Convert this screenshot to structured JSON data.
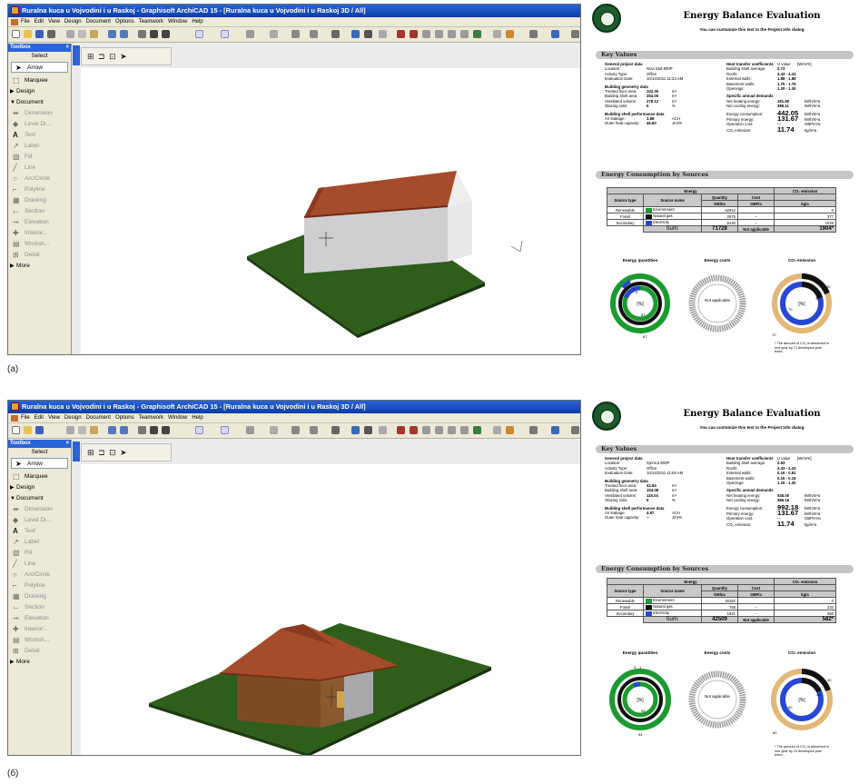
{
  "panels": [
    {
      "label": "(a)",
      "app": {
        "title": "Ruralna kuca u Vojvodini i u Raskoj - Graphisoft ArchiCAD 15 - [Ruralna kuca u Vojvodini i u Raskoj 3D / All]",
        "menus": [
          "File",
          "Edit",
          "View",
          "Design",
          "Document",
          "Options",
          "Teamwork",
          "Window",
          "Help"
        ],
        "toolbox": {
          "title": "Toolbox",
          "select": "Select",
          "tools_main": [
            "Arrow",
            "Marquee"
          ],
          "design_header": "Design",
          "document_header": "Document",
          "doc_tools": [
            "Dimension",
            "Level Di...",
            "Text",
            "Label",
            "Fill",
            "Line",
            "Arc/Circle",
            "Polyline",
            "Drawing",
            "Section",
            "Elevation",
            "Interior...",
            "Worksh...",
            "Detail"
          ],
          "more": "More"
        }
      },
      "report": {
        "title": "Energy Balance Evaluation",
        "subtitle": "You can customize this text in the Project Info dialog",
        "key_values_header": "Key Values",
        "general": {
          "header": "General project data",
          "rows": [
            [
              "Location:",
              "Novi Sad 800P"
            ],
            [
              "Activity Type:",
              "Office"
            ],
            [
              "Evaluation Date:",
              "10/14/2011 11:23 AM"
            ]
          ]
        },
        "geometry": {
          "header": "Building geometry data",
          "rows": [
            [
              "Treated floor area:",
              "102.30",
              "m²"
            ],
            [
              "Building shell area:",
              "254.00",
              "m²"
            ],
            [
              "Ventilated volume:",
              "278.12",
              "m³"
            ],
            [
              "Glazing ratio:",
              "6",
              "%"
            ]
          ]
        },
        "shell": {
          "header": "Building shell performance data",
          "rows": [
            [
              "Air leakage:",
              "3.88",
              "ACH"
            ],
            [
              "Outer heat capacity:",
              "46.60",
              "J/m²K"
            ]
          ]
        },
        "heat_transfer": {
          "header": "Heat transfer coefficients",
          "unit_head": "U value",
          "unit": "[W/m²K]",
          "rows": [
            [
              "Building shell average:",
              "2.73"
            ],
            [
              "Roofs:",
              "4.43 - 4.43"
            ],
            [
              "External walls:",
              "1.88 - 1.88"
            ],
            [
              "Basement walls:",
              "1.75 - 1.75"
            ],
            [
              "Openings:",
              "1.30 - 1.30"
            ]
          ]
        },
        "specific": {
          "header": "Specific annual demands",
          "rows": [
            [
              "Net heating energy:",
              "181.80",
              "kWh/m²a"
            ],
            [
              "Net cooling energy:",
              "386.11",
              "kWh/m²a"
            ]
          ]
        },
        "big": {
          "rows": [
            [
              "Energy consumption:",
              "442.05",
              "kWh/m²a"
            ],
            [
              "Primary energy:",
              "131.67",
              "kWh/m²a"
            ],
            [
              "Operation cost:",
              "---",
              "GBP/m²a"
            ],
            [
              "CO₂ emission:",
              "11.74",
              "kg/m²a"
            ]
          ]
        },
        "consumption_header": "Energy Consumption by Sources",
        "table": {
          "top_headers": [
            "Energy",
            "CO₂ emission"
          ],
          "headers": [
            "Source type",
            "Source name",
            "Quantity",
            "Cost"
          ],
          "units": [
            "kWh/a",
            "GBP/a",
            "kg/a"
          ],
          "rows": [
            {
              "type": "Renewable",
              "name": "Environment",
              "qty": "62912",
              "cost": "",
              "co2": "0",
              "color": "#1a9b2f"
            },
            {
              "type": "Fossil",
              "name": "Natural gas",
              "qty": "2675",
              "cost": "--",
              "co2": "377",
              "color": "#111111"
            },
            {
              "type": "Secondary",
              "name": "Electricity",
              "qty": "6140",
              "cost": "--",
              "co2": "1026",
              "color": "#2747d6"
            }
          ],
          "total_label": "Sum:",
          "total_qty": "71728",
          "total_cost": "Not applicable",
          "total_co2": "1904*"
        },
        "donut_titles": [
          "Energy quantities",
          "Energy costs",
          "CO₂ emission"
        ],
        "donut_center": "[%]",
        "na_text": "Not applicable",
        "qty_labels": [
          "4",
          "9",
          "87",
          "87"
        ],
        "co2_labels": [
          "30",
          "70",
          "70",
          "30"
        ],
        "note": "* The amount of CO₂ is absorbed in one year by 71 developed pine trees."
      }
    },
    {
      "label": "(б)",
      "app": {
        "title": "Ruralna kuca u Vojvodini i u Raskoj - Graphisoft ArchiCAD 15 - [Ruralna kuca u Vojvodini i u Raskoj 3D / All]",
        "menus": [
          "File",
          "Edit",
          "View",
          "Design",
          "Document",
          "Options",
          "Teamwork",
          "Window",
          "Help"
        ],
        "toolbox": {
          "title": "Toolbox",
          "select": "Select",
          "tools_main": [
            "Arrow",
            "Marquee"
          ],
          "design_header": "Design",
          "document_header": "Document",
          "doc_tools": [
            "Dimension",
            "Level Di...",
            "Text",
            "Label",
            "Fill",
            "Line",
            "Arc/Circle",
            "Polyline",
            "Drawing",
            "Section",
            "Elevation",
            "Interior...",
            "Worksh...",
            "Detail"
          ],
          "more": "More"
        }
      },
      "report": {
        "title": "Energy Balance Evaluation",
        "subtitle": "You can customize this text in the Project Info dialog",
        "key_values_header": "Key Values",
        "general": {
          "header": "General project data",
          "rows": [
            [
              "Location:",
              "Sjenica 800P"
            ],
            [
              "Activity Type:",
              "Office"
            ],
            [
              "Evaluation Date:",
              "10/14/2011 11:04 AM"
            ]
          ]
        },
        "geometry": {
          "header": "Building geometry data",
          "rows": [
            [
              "Treated floor area:",
              "42.84",
              "m²"
            ],
            [
              "Building shell area:",
              "154.08",
              "m²"
            ],
            [
              "Ventilated volume:",
              "115.04",
              "m³"
            ],
            [
              "Glazing ratio:",
              "5",
              "%"
            ]
          ]
        },
        "shell": {
          "header": "Building shell performance data",
          "rows": [
            [
              "Air leakage:",
              "4.87",
              "ACH"
            ],
            [
              "Outer heat capacity:",
              "--",
              "J/m²K"
            ]
          ]
        },
        "heat_transfer": {
          "header": "Heat transfer coefficients",
          "unit_head": "U value",
          "unit": "[W/m²K]",
          "rows": [
            [
              "Building shell average:",
              "2.53"
            ],
            [
              "Roofs:",
              "4.43 - 4.43"
            ],
            [
              "External walls:",
              "0.16 - 0.81"
            ],
            [
              "Basement walls:",
              "0.16 - 0.16"
            ],
            [
              "Openings:",
              "1.30 - 1.30"
            ]
          ]
        },
        "specific": {
          "header": "Specific annual demands",
          "rows": [
            [
              "Net heating energy:",
              "548.00",
              "kWh/m²a"
            ],
            [
              "Net cooling energy:",
              "386.16",
              "kWh/m²a"
            ]
          ]
        },
        "big": {
          "rows": [
            [
              "Energy consumption:",
              "992.18",
              "kWh/m²a"
            ],
            [
              "Primary energy:",
              "131.67",
              "kWh/m²a"
            ],
            [
              "Operation cost:",
              "---",
              "GBP/m²a"
            ],
            [
              "CO₂ emission:",
              "11.74",
              "kg/m²a"
            ]
          ]
        },
        "consumption_header": "Energy Consumption by Sources",
        "table": {
          "top_headers": [
            "Energy",
            "CO₂ emission"
          ],
          "headers": [
            "Source type",
            "Source name",
            "Quantity",
            "Cost"
          ],
          "units": [
            "kWh/a",
            "GBP/a",
            "kg/a"
          ],
          "rows": [
            {
              "type": "Renewable",
              "name": "Environment",
              "qty": "40182",
              "cost": "",
              "co2": "0",
              "color": "#1a9b2f"
            },
            {
              "type": "Fossil",
              "name": "Natural gas",
              "qty": "756",
              "cost": "--",
              "co2": "232",
              "color": "#111111"
            },
            {
              "type": "Secondary",
              "name": "Electricity",
              "qty": "1821",
              "cost": "--",
              "co2": "350",
              "color": "#2747d6"
            }
          ],
          "total_label": "Sum:",
          "total_qty": "42509",
          "total_cost": "Not applicable",
          "total_co2": "582*"
        },
        "donut_titles": [
          "Energy quantities",
          "Energy costs",
          "CO₂ emission"
        ],
        "donut_center": "[%]",
        "na_text": "Not applicable",
        "qty_labels": [
          "4",
          "1",
          "95",
          "94"
        ],
        "co2_labels": [
          "40",
          "60",
          "60",
          "40"
        ],
        "note": "* The amount of CO₂ is absorbed in one year by 19 developed pine trees."
      }
    }
  ],
  "colors": {
    "renewable": "#1a9b2f",
    "fossil": "#111111",
    "secondary": "#2747d6",
    "co2_light": "#e2b777",
    "roof": "#a54c2b",
    "grass": "#2e5e1a"
  }
}
